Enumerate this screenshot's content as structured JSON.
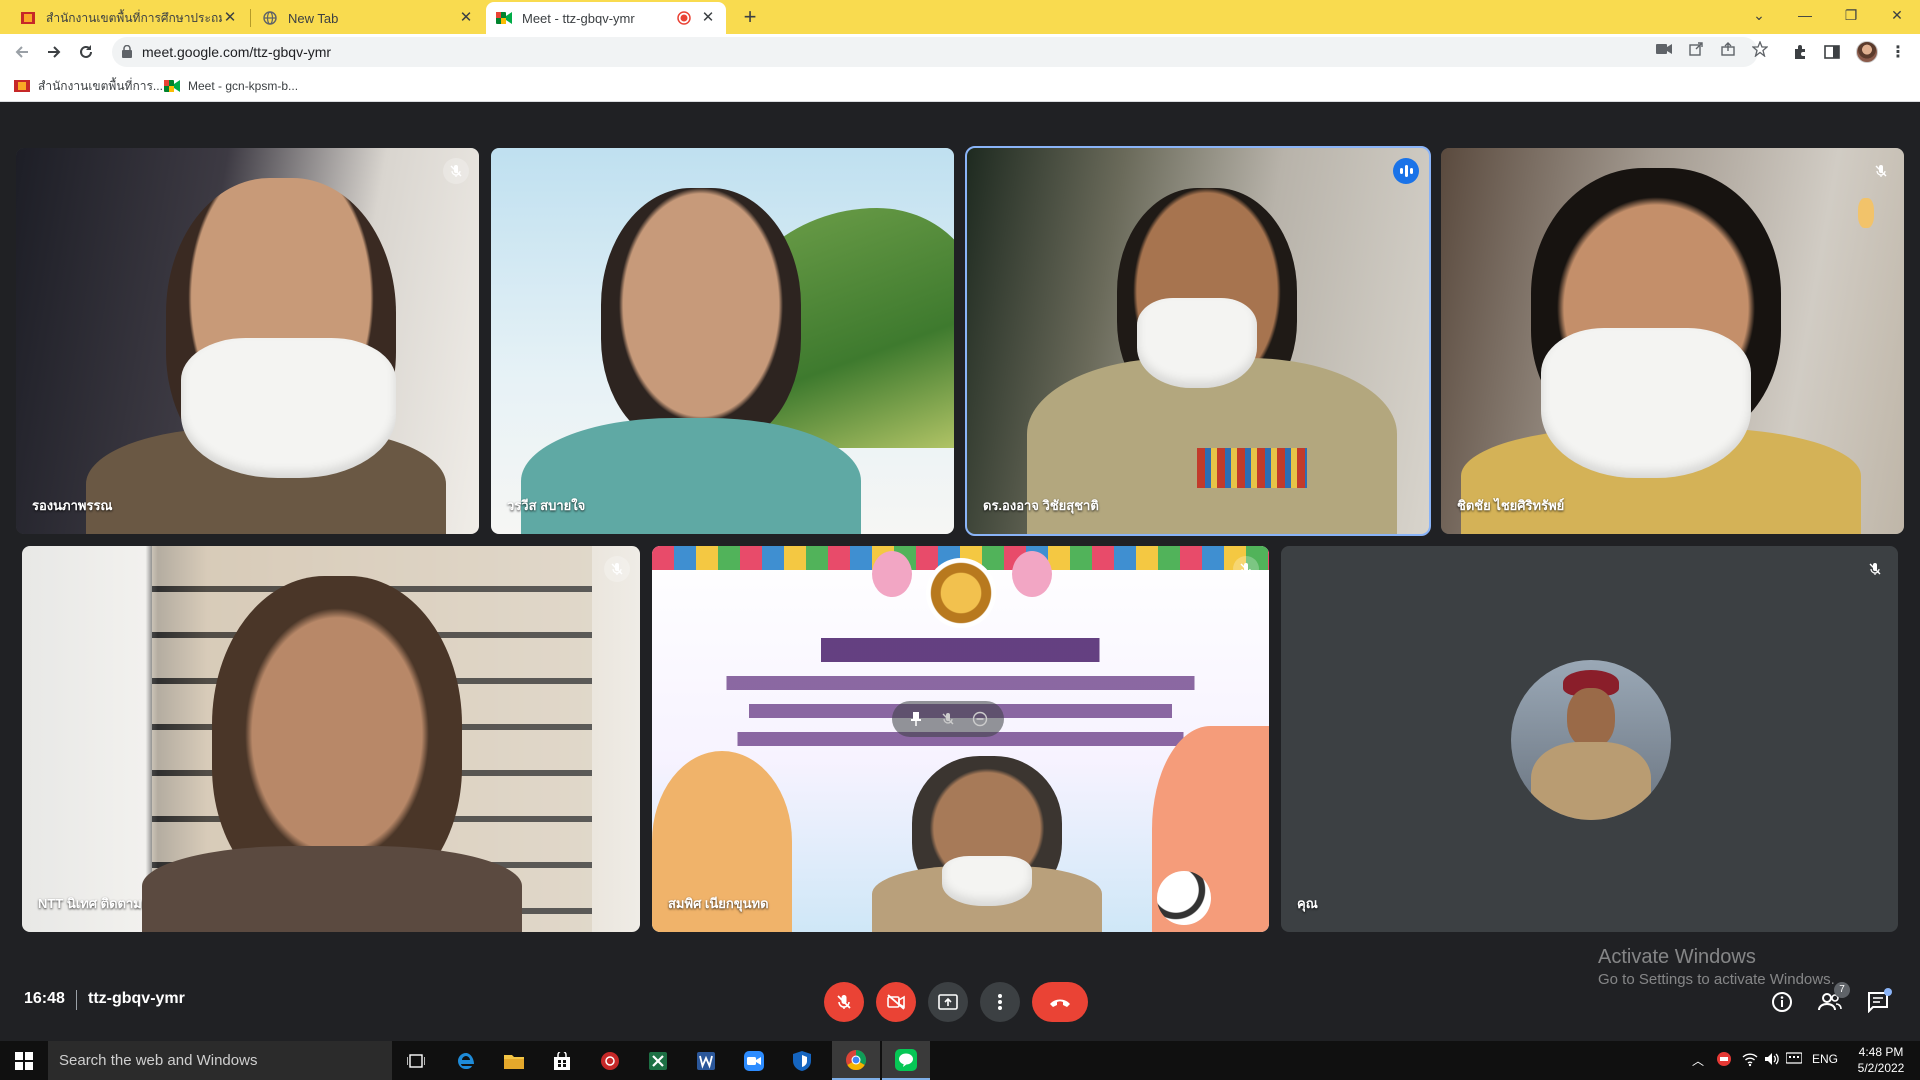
{
  "browser": {
    "tabs": [
      {
        "label": "สำนักงานเขตพื้นที่การศึกษาประถมศึกษ",
        "active": false
      },
      {
        "label": "New Tab",
        "active": false
      },
      {
        "label": "Meet - ttz-gbqv-ymr",
        "active": true
      }
    ],
    "url": "meet.google.com/ttz-gbqv-ymr",
    "bookmarks": [
      {
        "label": "สำนักงานเขตพื้นที่การ..."
      },
      {
        "label": "Meet - gcn-kpsm-b..."
      }
    ]
  },
  "meeting": {
    "time": "16:48",
    "code": "ttz-gbqv-ymr",
    "people_count": "7",
    "participants": [
      {
        "name": "รองนภาพรรณ",
        "muted": true
      },
      {
        "name": "วรวีส สบายใจ",
        "muted": false
      },
      {
        "name": "ดร.องอาจ วิชัยสุชาติ",
        "muted": false,
        "speaking": true
      },
      {
        "name": "ชิตชัย ไชยศิริทรัพย์",
        "muted": true
      },
      {
        "name": "NTT นิเทศ ติดตาม",
        "muted": true
      },
      {
        "name": "สมพิศ เนียกขุนทด",
        "muted": true
      },
      {
        "name": "คุณ",
        "muted": true
      }
    ]
  },
  "watermark": {
    "line1": "Activate Windows",
    "line2": "Go to Settings to activate Windows."
  },
  "taskbar": {
    "search_placeholder": "Search the web and Windows",
    "language": "ENG",
    "time": "4:48 PM",
    "date": "5/2/2022"
  }
}
